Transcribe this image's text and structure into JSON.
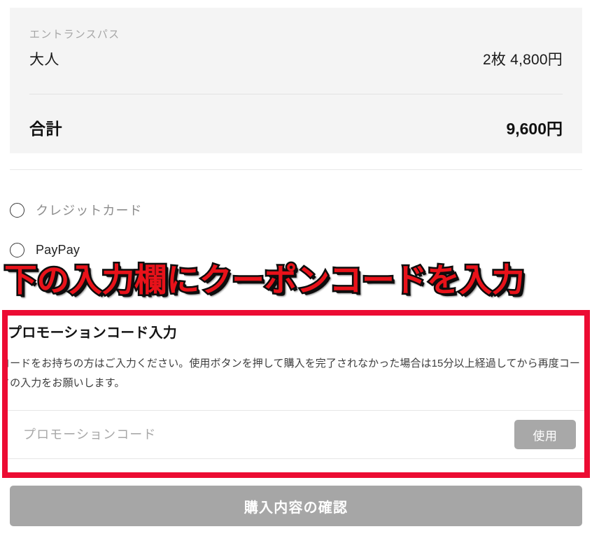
{
  "summary": {
    "category_label": "エントランスパス",
    "items": [
      {
        "name": "大人",
        "price": "2枚 4,800円"
      }
    ],
    "total_label": "合計",
    "total_value": "9,600円"
  },
  "payment": {
    "options": [
      {
        "label": "クレジットカード",
        "selected": false
      },
      {
        "label": "PayPay",
        "selected": false
      }
    ]
  },
  "annotation": {
    "text": "下の入力欄にクーポンコードを入力",
    "text_color": "#e8121a",
    "outline_color": "#0d0d0d"
  },
  "promo": {
    "title": "プロモーションコード入力",
    "description": "コードをお持ちの方はご入力ください。使用ボタンを押して購入を完了されなかった場合は15分以上経過してから再度コードの入力をお願いします。",
    "input_value": "",
    "input_placeholder": "プロモーションコード",
    "apply_label": "使用",
    "highlight_color": "#ec0c33"
  },
  "footer": {
    "confirm_label": "購入内容の確認",
    "confirm_color": "#a6a6a6"
  }
}
